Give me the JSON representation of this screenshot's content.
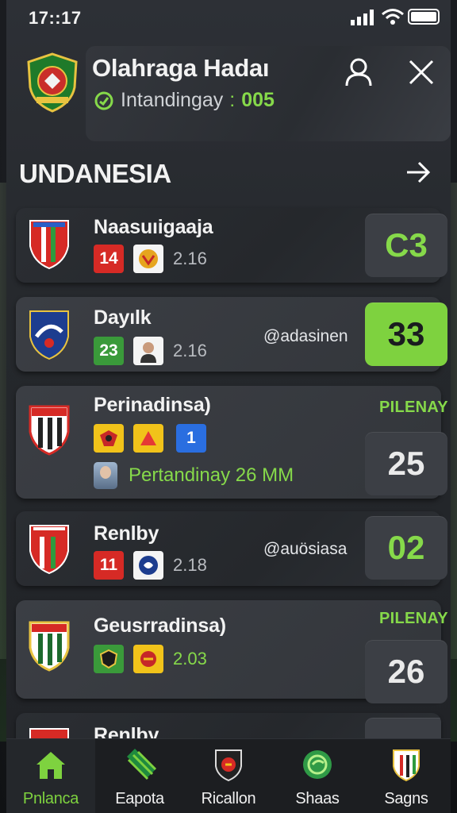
{
  "status_bar": {
    "time": "17::17"
  },
  "header": {
    "title": "Olahraga Hadaı",
    "subtitle": "Intandingay",
    "subtitle_value": "005"
  },
  "section": {
    "title": "UNDANESIA"
  },
  "matches": [
    {
      "team": "Naasuıigaaja",
      "chip1": "14",
      "odds": "2.16",
      "score": "C3",
      "score_style": "green-text"
    },
    {
      "team": "Dayılk",
      "chip1": "23",
      "odds": "2.16",
      "handle": "@adasinen",
      "score": "33",
      "score_style": "green-fill"
    },
    {
      "team": "Perinadinsa)",
      "label": "PILENAY",
      "chip2": "1",
      "player": "Pertandinay 26 MM",
      "score": "25",
      "score_style": "plain"
    },
    {
      "team": "Renlby",
      "chip1": "11",
      "odds": "2.18",
      "handle": "@auösiasa",
      "score": "02",
      "score_style": "green-text"
    },
    {
      "team": "Geusrradinsa)",
      "label": "PILENAY",
      "odds": "2.03",
      "score": "26",
      "score_style": "plain"
    },
    {
      "team": "Renlby"
    }
  ],
  "nav": [
    {
      "label": "Pnlanca",
      "icon": "home-icon",
      "active": true
    },
    {
      "label": "Eapota",
      "icon": "stripes-icon"
    },
    {
      "label": "Ricallon",
      "icon": "shield-icon"
    },
    {
      "label": "Shaas",
      "icon": "ball-icon"
    },
    {
      "label": "Sagns",
      "icon": "crest-icon"
    }
  ],
  "colors": {
    "accent_green": "#7ed23f",
    "chip_red": "#d62a25",
    "chip_green": "#3a9a3a",
    "chip_yellow": "#f1c31a",
    "chip_blue": "#2a6ee0"
  }
}
